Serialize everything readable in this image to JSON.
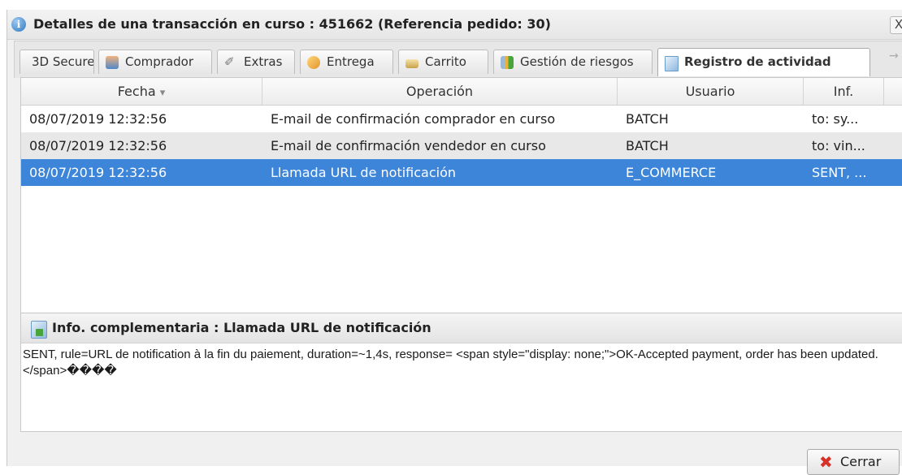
{
  "window": {
    "title": "Detalles de una transacción en curso : 451662 (Referencia pedido: 30)",
    "close_glyph": "X"
  },
  "tabs": [
    {
      "label": "3D Secure",
      "icon": "arrow-left-icon"
    },
    {
      "label": "Comprador",
      "icon": "user-icon"
    },
    {
      "label": "Extras",
      "icon": "paperclip-icon"
    },
    {
      "label": "Entrega",
      "icon": "package-icon"
    },
    {
      "label": "Carrito",
      "icon": "cart-icon"
    },
    {
      "label": "Gestión de riesgos",
      "icon": "chart-icon"
    },
    {
      "label": "Registro de actividad",
      "icon": "log-icon",
      "active": true
    }
  ],
  "grid": {
    "columns": [
      "Fecha",
      "Operación",
      "Usuario",
      "Inf."
    ],
    "sort_indicator": "▾",
    "rows": [
      {
        "fecha": "08/07/2019 12:32:56",
        "operacion": "E-mail de confirmación comprador en curso",
        "usuario": "BATCH",
        "inf": "to: sy..."
      },
      {
        "fecha": "08/07/2019 12:32:56",
        "operacion": "E-mail de confirmación vendedor en curso",
        "usuario": "BATCH",
        "inf": "to: vin..."
      },
      {
        "fecha": "08/07/2019 12:32:56",
        "operacion": "Llamada URL de notificación",
        "usuario": "E_COMMERCE",
        "inf": "SENT, ...",
        "selected": true
      }
    ]
  },
  "info": {
    "title": "Info. complementaria : Llamada URL de notificación",
    "body": "SENT, rule=URL de notification à la fin du paiement, duration=~1,4s, response= <span style=\"display: none;\">OK-Accepted payment, order has been updated. </span>����"
  },
  "footer": {
    "close_label": "Cerrar"
  },
  "colors": {
    "selection": "#3d85d9",
    "alt_row": "#e8e8e8",
    "close_icon": "#d8312a"
  }
}
